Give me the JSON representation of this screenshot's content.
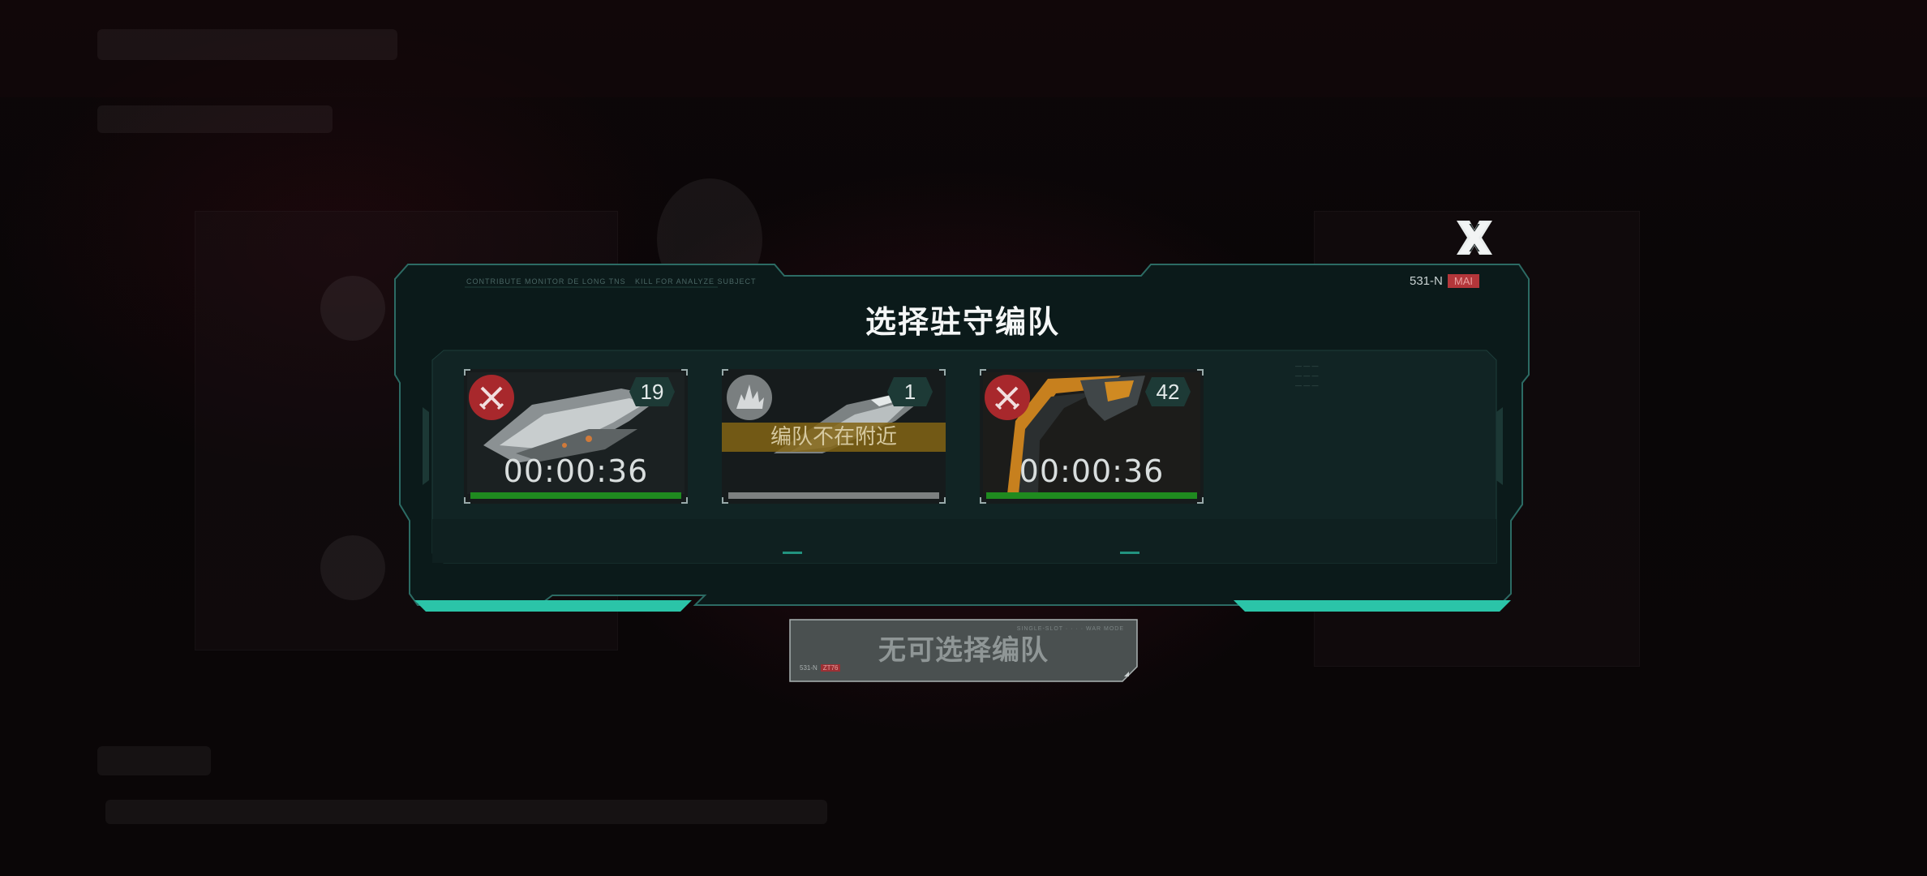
{
  "dialog": {
    "title": "选择驻守编队",
    "top_small_text_1": "CONTRIBUTE  MONITOR DE LONG TNS",
    "top_small_text_2": "KILL FOR ANALYZE SUBJECT",
    "corner_code": "531-N",
    "corner_tag": "MAI",
    "close_icon": "close-x-icon"
  },
  "fleets": [
    {
      "type_icon": "crossed-swords-icon",
      "type_color": "#a8282c",
      "count": "19",
      "timer": "00:00:36",
      "bar_color": "#1f8a1f",
      "progress": 1.0,
      "notice": ""
    },
    {
      "type_icon": "explosion-icon",
      "type_color": "#7a7f80",
      "count": "1",
      "timer": "",
      "bar_color": "#7d8181",
      "progress": 1.0,
      "notice": "编队不在附近"
    },
    {
      "type_icon": "crossed-swords-icon",
      "type_color": "#a8282c",
      "count": "42",
      "timer": "00:00:36",
      "bar_color": "#1f8a1f",
      "progress": 1.0,
      "notice": ""
    }
  ],
  "confirm_button": {
    "label": "无可选择编队",
    "mini_code": "531-N",
    "mini_tag": "ZT76",
    "tiny_text": "SINGLE-SLOT · · · · WAR MODE"
  },
  "colors": {
    "accent": "#2bc4a8",
    "frame_border": "#2d6a63",
    "dialog_bg": "#0c1c1c"
  }
}
